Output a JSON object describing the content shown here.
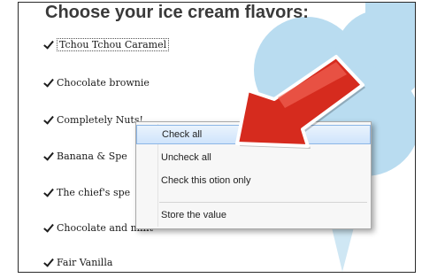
{
  "title": "Choose your ice cream flavors:",
  "flavors": [
    "Tchou Tchou Caramel",
    "Chocolate brownie",
    "Completely Nuts!",
    "Banana & Spe",
    "The chief's spe",
    "Chocolate and mint",
    "Fair Vanilla"
  ],
  "context_menu": {
    "items": [
      "Check all",
      "Uncheck all",
      "Check this otion only",
      "Store the value"
    ],
    "highlighted_index": 0
  },
  "icons": [
    "checkbox-checked-icon",
    "red-arrow-icon",
    "ice-cream-cone-icon"
  ],
  "colors": {
    "arrow": "#d62b1e",
    "ice_cream": "#b9dcf0",
    "menu_highlight": "#cfe4fb"
  }
}
